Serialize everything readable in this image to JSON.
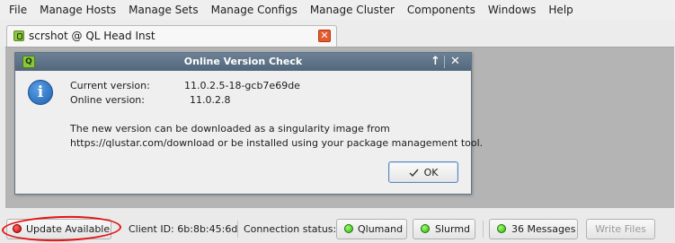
{
  "menubar": {
    "items": [
      "File",
      "Manage Hosts",
      "Manage Sets",
      "Manage Configs",
      "Manage Cluster",
      "Components",
      "Windows",
      "Help"
    ]
  },
  "tab": {
    "label": "scrshot @ QL Head Inst",
    "close_glyph": "✕"
  },
  "dialog": {
    "title": "Online Version Check",
    "app_icon_letter": "Q",
    "up_glyph": "↑",
    "close_glyph": "✕",
    "info_glyph": "i",
    "current_label": "Current version:",
    "current_value": "11.0.2.5-18-gcb7e69de",
    "online_label": "Online version:",
    "online_value": "11.0.2.8",
    "message_line1": "The new version can be downloaded as a singularity image from",
    "message_line2": "https://qlustar.com/download or be installed using your package management tool.",
    "ok_label": "OK"
  },
  "statusbar": {
    "update_label": "Update Available",
    "client_id": "Client ID:  6b:8b:45:6d",
    "connection_label": "Connection status:",
    "qlumand_label": "Qlumand",
    "slurmd_label": "Slurmd",
    "messages_label": "36 Messages",
    "write_files_label": "Write Files"
  },
  "colors": {
    "led_red": "#d10000",
    "led_green": "#33b31a",
    "highlight": "#e21515",
    "titlebar": "#5e7286"
  },
  "icons": {
    "tab_icon": "qlustar-app-icon",
    "tab_close": "close-icon",
    "dialog_icon": "qlustar-app-icon",
    "info": "info-icon",
    "ok": "check-icon"
  }
}
